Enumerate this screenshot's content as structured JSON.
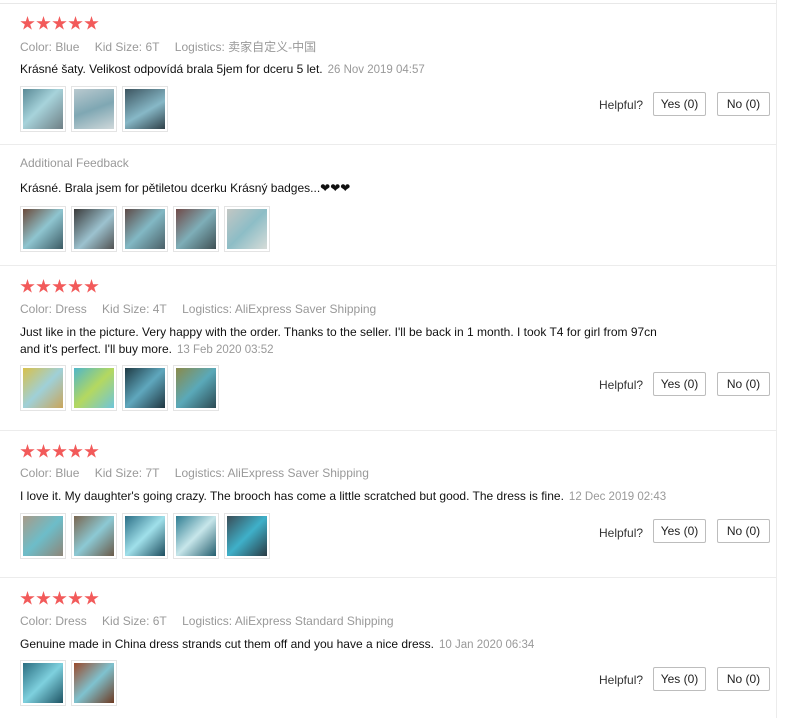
{
  "labels": {
    "color": "Color:",
    "kid_size": "Kid Size:",
    "logistics": "Logistics:",
    "helpful": "Helpful?",
    "additional_feedback": "Additional Feedback"
  },
  "reviews": [
    {
      "rating": 5,
      "color": "Blue",
      "kid_size": "6T",
      "logistics": "卖家自定义-中国",
      "text": "Krásné šaty. Velikost odpovídá brala 5jem for dceru 5 let.",
      "date": "26 Nov 2019 04:57",
      "photo_count": 3,
      "yes": "Yes (0)",
      "no": "No (0)",
      "additional": {
        "text": "Krásné. Brala jsem for pětiletou dcerku Krásný badges...",
        "hearts": "❤❤❤",
        "photo_count": 5
      }
    },
    {
      "rating": 5,
      "color": "Dress",
      "kid_size": "4T",
      "logistics": "AliExpress Saver Shipping",
      "text_line1": "Just like in the picture. Very happy with the order. Thanks to the seller. I'll be back in 1 month. I took T4 for girl from 97cn",
      "text_line2": "and it's perfect. I'll buy more.",
      "date": "13 Feb 2020 03:52",
      "photo_count": 4,
      "yes": "Yes (0)",
      "no": "No (0)"
    },
    {
      "rating": 5,
      "color": "Blue",
      "kid_size": "7T",
      "logistics": "AliExpress Saver Shipping",
      "text": "I love it. My daughter's going crazy. The brooch has come a little scratched but good. The dress is fine.",
      "date": "12 Dec 2019 02:43",
      "photo_count": 5,
      "yes": "Yes (0)",
      "no": "No (0)"
    },
    {
      "rating": 5,
      "color": "Dress",
      "kid_size": "6T",
      "logistics": "AliExpress Standard Shipping",
      "text": "Genuine made in China dress strands cut them off and you have a nice dress.",
      "date": "10 Jan 2020 06:34",
      "photo_count": 2,
      "yes": "Yes (0)",
      "no": "No (0)"
    }
  ],
  "colors": {
    "star": "#f25a5a",
    "muted": "#999999",
    "border": "#bdbdbd"
  }
}
